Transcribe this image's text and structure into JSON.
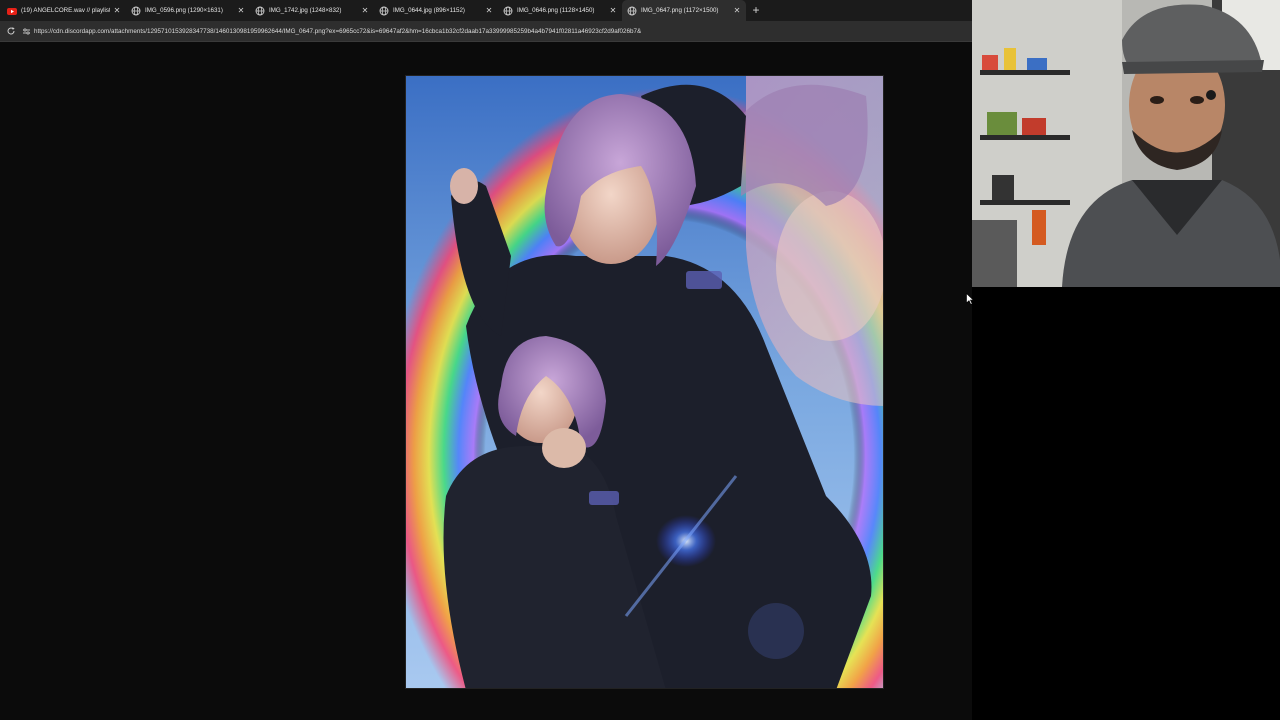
{
  "browser": {
    "tabs": [
      {
        "title": "(19) ANGELCORE.wav // playlist (w",
        "icon": "youtube-icon",
        "active": false
      },
      {
        "title": "IMG_0596.png (1290×1631)",
        "icon": "globe-icon",
        "active": false
      },
      {
        "title": "IMG_1742.jpg (1248×832)",
        "icon": "globe-icon",
        "active": false
      },
      {
        "title": "IMG_0644.jpg (896×1152)",
        "icon": "globe-icon",
        "active": false
      },
      {
        "title": "IMG_0646.png (1128×1450)",
        "icon": "globe-icon",
        "active": false
      },
      {
        "title": "IMG_0647.png (1172×1500)",
        "icon": "globe-icon",
        "active": true
      }
    ],
    "new_tab_label": "+",
    "address": "https://cdn.discordapp.com/attachments/1295710153928347738/1460130981959962644/IMG_0647.png?ex=6965cc72&is=69647af2&hm=16cbca1b32cf2daab17a33999985259b4a4b7941f02811a46923cf2d9af026b7&"
  },
  "content": {
    "image_description_icon": "photo-collage",
    "colors": {
      "page_background": "#0b0b0b",
      "tab_strip": "#1b1b1b",
      "active_tab": "#2e2e2e"
    }
  },
  "overlay": {
    "webcam_icon": "webcam-feed"
  }
}
